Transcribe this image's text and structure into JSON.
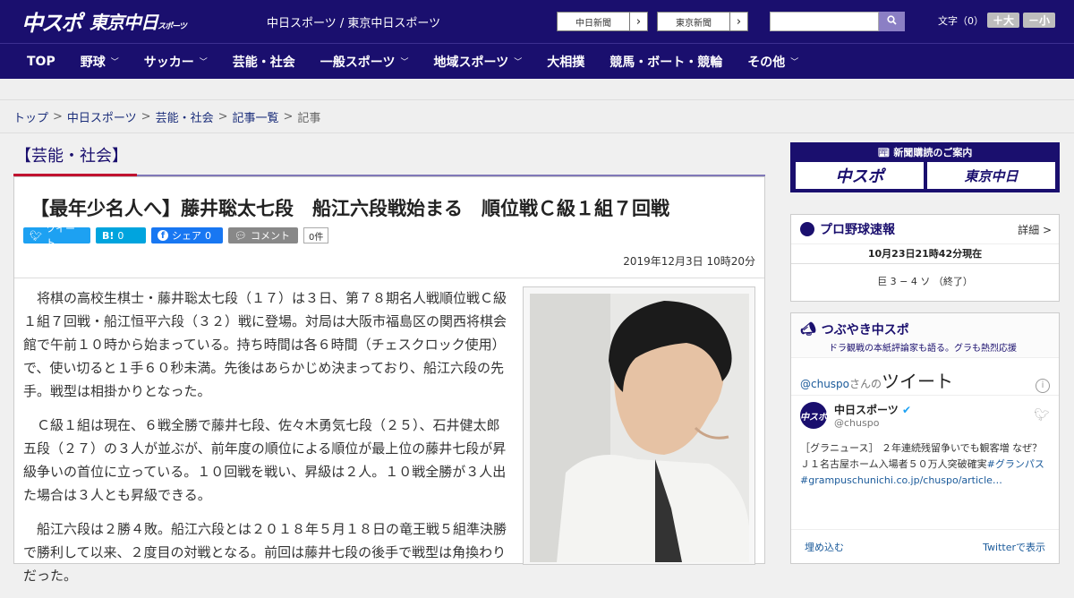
{
  "header": {
    "logo_main": "中スポ",
    "logo_tokyo": "東京中日",
    "logo_tokyo_small": "スポーツ",
    "site_links": "中日スポーツ / 東京中日スポーツ",
    "paper_buttons": [
      "中日新聞",
      "東京新聞"
    ],
    "search_placeholder": "",
    "font_size_label": "文字（0）",
    "font_bigger": "＋大",
    "font_smaller": "－小"
  },
  "nav": {
    "items": [
      {
        "label": "TOP",
        "has_dropdown": false
      },
      {
        "label": "野球",
        "has_dropdown": true
      },
      {
        "label": "サッカー",
        "has_dropdown": true
      },
      {
        "label": "芸能・社会",
        "has_dropdown": false
      },
      {
        "label": "一般スポーツ",
        "has_dropdown": true
      },
      {
        "label": "地域スポーツ",
        "has_dropdown": true
      },
      {
        "label": "大相撲",
        "has_dropdown": false
      },
      {
        "label": "競馬・ボート・競輪",
        "has_dropdown": false
      },
      {
        "label": "その他",
        "has_dropdown": true
      }
    ]
  },
  "breadcrumb": [
    "トップ",
    "中日スポーツ",
    "芸能・社会",
    "記事一覧",
    "記事"
  ],
  "category": "【芸能・社会】",
  "article": {
    "headline": "【最年少名人へ】藤井聡太七段　船江六段戦始まる　順位戦Ｃ級１組７回戦",
    "share": {
      "tweet": "ツイート",
      "hatena": "B!",
      "hatena_count": "0",
      "facebook": "シェア",
      "facebook_count": "0",
      "comment": "コメント",
      "comment_count": "0件"
    },
    "datetime": "2019年12月3日 10時20分",
    "paragraphs": [
      "将棋の高校生棋士・藤井聡太七段（１７）は３日、第７８期名人戦順位戦Ｃ級１組７回戦・船江恒平六段（３２）戦に登場。対局は大阪市福島区の関西将棋会館で午前１０時から始まっている。持ち時間は各６時間（チェスクロック使用）で、使い切ると１手６０秒未満。先後はあらかじめ決まっており、船江六段の先手。戦型は相掛かりとなった。",
      "Ｃ級１組は現在、６戦全勝で藤井七段、佐々木勇気七段（２５）、石井健太郎五段（２７）の３人が並ぶが、前年度の順位による順位が最上位の藤井七段が昇級争いの首位に立っている。１０回戦を戦い、昇級は２人。１０戦全勝が３人出た場合は３人とも昇級できる。",
      "船江六段は２勝４敗。船江六段とは２０１８年５月１８日の竜王戦５組準決勝で勝利して以来、２度目の対戦となる。前回は藤井七段の後手で戦型は角換わりだった。"
    ]
  },
  "sidebar": {
    "subscribe": {
      "title": "新聞購読のご案内",
      "left": "中スポ",
      "right": "東京中日"
    },
    "baseball": {
      "title": "プロ野球速報",
      "more": "詳細 >",
      "time": "10月23日21時42分現在",
      "score": "巨 3 − 4 ソ （終了）"
    },
    "tweets": {
      "title": "つぶやき中スポ",
      "subtitle": "ドラ観戦の本紙評論家も語る。グラも熱烈応援",
      "handle_prefix": "@chuspo",
      "handle_suffix": "さんの",
      "heading": "ツイート",
      "user_name": "中日スポーツ",
      "user_handle": "@chuspo",
      "text_plain": "［グラニュース］ ２年連続残留争いでも観客増 なぜ？ Ｊ１名古屋ホーム入場者５０万人突破確実",
      "text_link": "#グランパス #grampuschunichi.co.jp/chuspo/article…",
      "embed": "埋め込む",
      "view_on_twitter": "Twitterで表示"
    }
  },
  "colors": {
    "brand": "#1a0f6e",
    "accent_red": "#c0122f"
  }
}
